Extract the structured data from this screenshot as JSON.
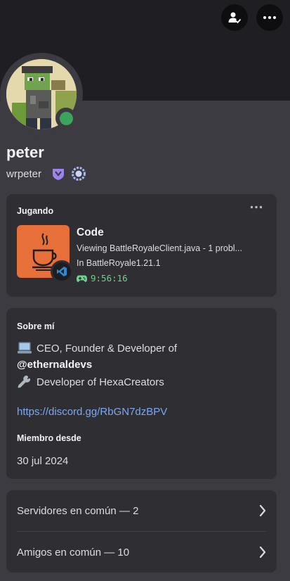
{
  "profile": {
    "display_name": "peter",
    "username": "wrpeter",
    "status_color": "#3ba55d"
  },
  "header": {
    "friend_icon": "person-check-icon",
    "more_icon": "ellipsis-icon"
  },
  "activity": {
    "heading": "Jugando",
    "app_name": "Code",
    "details": "Viewing BattleRoyaleClient.java - 1 probl...",
    "state": "In BattleRoyale1.21.1",
    "elapsed": "9:56:16",
    "icon_color": "#e76f3a"
  },
  "about": {
    "heading": "Sobre mí",
    "line1": "CEO, Founder & Developer of",
    "line2": "@ethernaldevs",
    "line3": "Developer of HexaCreators",
    "link": "https://discord.gg/RbGN7dzBPV",
    "member_heading": "Miembro desde",
    "member_date": "30 jul 2024"
  },
  "mutuals": {
    "servers": "Servidores en común — 2",
    "friends": "Amigos en común — 10"
  }
}
